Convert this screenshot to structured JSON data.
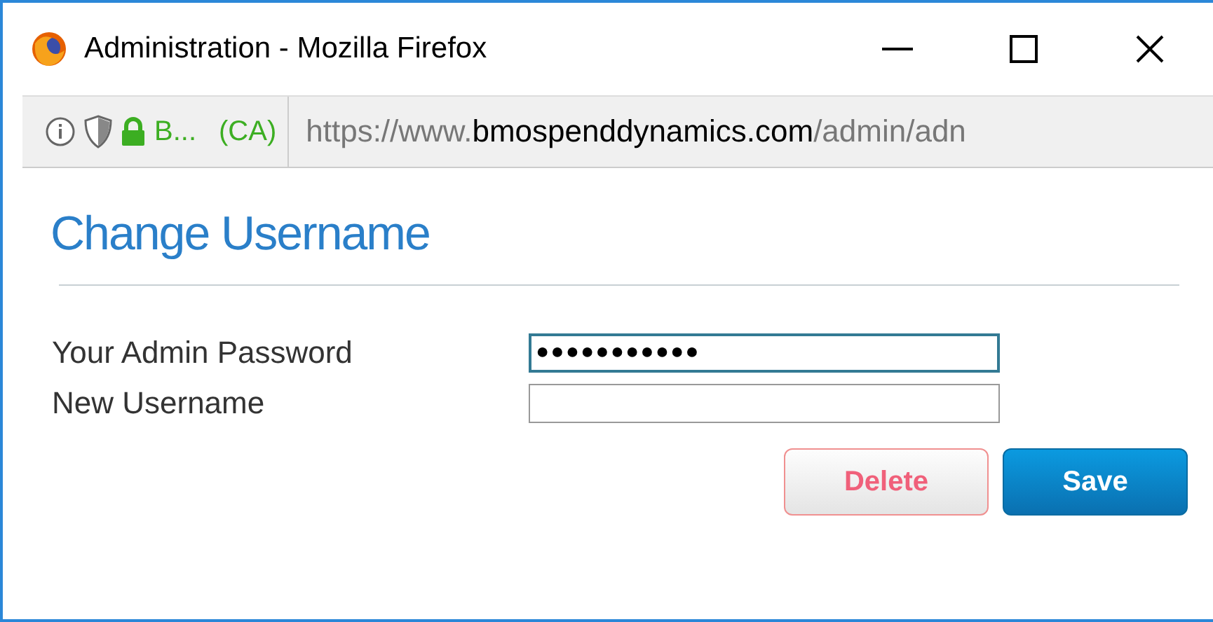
{
  "window": {
    "title": "Administration - Mozilla Firefox"
  },
  "address_bar": {
    "site_label": "B...",
    "site_country": "(CA)",
    "url_prefix": "https://www.",
    "url_domain": "bmospenddynamics.com",
    "url_path": "/admin/adn"
  },
  "page": {
    "heading": "Change Username",
    "fields": [
      {
        "label": "Your Admin Password",
        "value": "●●●●●●●●●●●",
        "focused": true
      },
      {
        "label": "New Username",
        "focused": false
      }
    ],
    "buttons": [
      {
        "label": "Delete",
        "kind": "danger"
      },
      {
        "label": "Save",
        "kind": "primary"
      }
    ]
  }
}
